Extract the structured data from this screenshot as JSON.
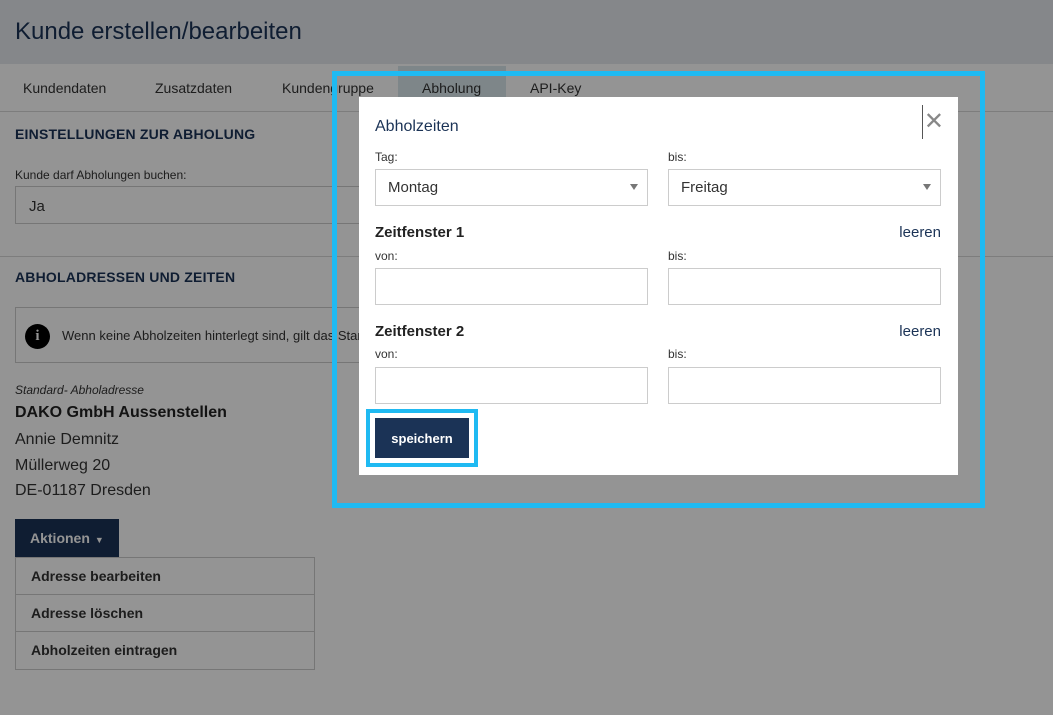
{
  "page": {
    "title": "Kunde erstellen/bearbeiten",
    "tabs": [
      {
        "label": "Kundendaten"
      },
      {
        "label": "Zusatzdaten"
      },
      {
        "label": "Kundengruppe"
      },
      {
        "label": "Abholung"
      },
      {
        "label": "API-Key"
      }
    ],
    "active_tab": "Abholung"
  },
  "pickup_settings": {
    "section_title": "EINSTELLUNGEN ZUR ABHOLUNG",
    "allow_label": "Kunde darf Abholungen buchen:",
    "allow_value": "Ja"
  },
  "addresses": {
    "section_title": "ABHOLADRESSEN UND ZEITEN",
    "info_text": "Wenn keine Abholzeiten hinterlegt sind, gilt das Standard",
    "caption": "Standard- Abholadresse",
    "company": "DAKO GmbH Aussenstellen",
    "contact": "Annie Demnitz",
    "street": "Müllerweg 20",
    "city": "DE-01187 Dresden",
    "actions_label": "Aktionen",
    "menu": [
      {
        "label": "Adresse bearbeiten"
      },
      {
        "label": "Adresse löschen"
      },
      {
        "label": "Abholzeiten eintragen"
      }
    ]
  },
  "modal": {
    "title": "Abholzeiten",
    "close_symbol": "✕",
    "day_from_label": "Tag:",
    "day_from_value": "Montag",
    "day_to_label": "bis:",
    "day_to_value": "Freitag",
    "window1": {
      "title": "Zeitfenster 1",
      "clear_label": "leeren",
      "from_label": "von:",
      "to_label": "bis:",
      "from_value": "",
      "to_value": ""
    },
    "window2": {
      "title": "Zeitfenster 2",
      "clear_label": "leeren",
      "from_label": "von:",
      "to_label": "bis:",
      "from_value": "",
      "to_value": ""
    },
    "save_label": "speichern"
  },
  "colors": {
    "primary": "#1b3356",
    "highlight": "#1fbaf2"
  }
}
